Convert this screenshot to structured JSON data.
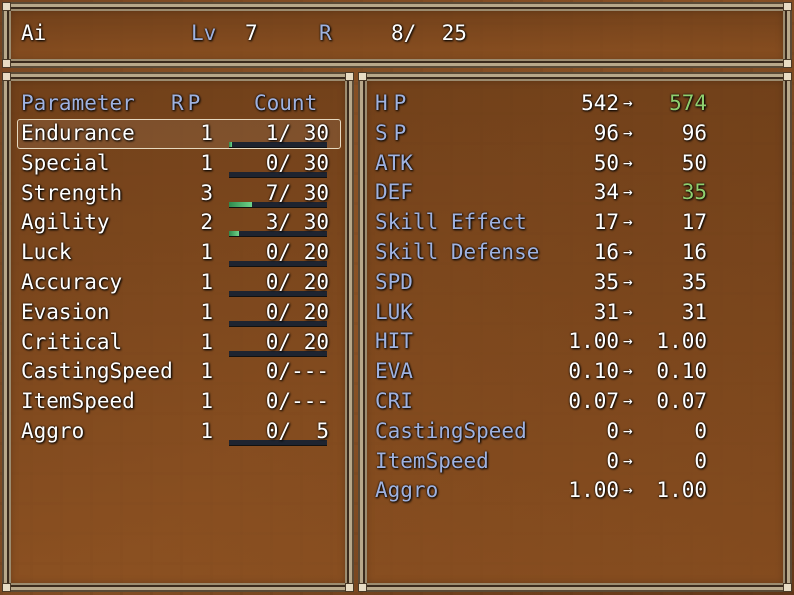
{
  "header": {
    "name": "Ai",
    "level_label": "Lv",
    "level": "7",
    "points_label": "R",
    "points": "8/  25"
  },
  "params_table": {
    "headers": {
      "parameter": "Parameter",
      "rp": "RP",
      "count": "Count"
    },
    "rows": [
      {
        "name": "Endurance",
        "rp": "1",
        "count": "1/ 30",
        "progress": 0.033,
        "has_bar": true
      },
      {
        "name": "Special",
        "rp": "1",
        "count": "0/ 30",
        "progress": 0.0,
        "has_bar": true
      },
      {
        "name": "Strength",
        "rp": "3",
        "count": "7/ 30",
        "progress": 0.233,
        "has_bar": true
      },
      {
        "name": "Agility",
        "rp": "2",
        "count": "3/ 30",
        "progress": 0.1,
        "has_bar": true
      },
      {
        "name": "Luck",
        "rp": "1",
        "count": "0/ 20",
        "progress": 0.0,
        "has_bar": true
      },
      {
        "name": "Accuracy",
        "rp": "1",
        "count": "0/ 20",
        "progress": 0.0,
        "has_bar": true
      },
      {
        "name": "Evasion",
        "rp": "1",
        "count": "0/ 20",
        "progress": 0.0,
        "has_bar": true
      },
      {
        "name": "Critical",
        "rp": "1",
        "count": "0/ 20",
        "progress": 0.0,
        "has_bar": true
      },
      {
        "name": "CastingSpeed",
        "rp": "1",
        "count": "0/---",
        "progress": 0.0,
        "has_bar": false
      },
      {
        "name": "ItemSpeed",
        "rp": "1",
        "count": "0/---",
        "progress": 0.0,
        "has_bar": false
      },
      {
        "name": "Aggro",
        "rp": "1",
        "count": "0/  5",
        "progress": 0.0,
        "has_bar": true
      }
    ],
    "selected_index": 0
  },
  "stats": {
    "arrow": "→",
    "rows": [
      {
        "name": "HP",
        "current": "542",
        "next": "574",
        "increased": true,
        "system": true
      },
      {
        "name": "SP",
        "current": "96",
        "next": "96",
        "increased": false,
        "system": true
      },
      {
        "name": "ATK",
        "current": "50",
        "next": "50",
        "increased": false,
        "system": true
      },
      {
        "name": "DEF",
        "current": "34",
        "next": "35",
        "increased": true,
        "system": true
      },
      {
        "name": "Skill Effect",
        "current": "17",
        "next": "17",
        "increased": false,
        "system": true
      },
      {
        "name": "Skill Defense",
        "current": "16",
        "next": "16",
        "increased": false,
        "system": true
      },
      {
        "name": "SPD",
        "current": "35",
        "next": "35",
        "increased": false,
        "system": true
      },
      {
        "name": "LUK",
        "current": "31",
        "next": "31",
        "increased": false,
        "system": true
      },
      {
        "name": "HIT",
        "current": "1.00",
        "next": "1.00",
        "increased": false,
        "system": true
      },
      {
        "name": "EVA",
        "current": "0.10",
        "next": "0.10",
        "increased": false,
        "system": true
      },
      {
        "name": "CRI",
        "current": "0.07",
        "next": "0.07",
        "increased": false,
        "system": true
      },
      {
        "name": "CastingSpeed",
        "current": "0",
        "next": "0",
        "increased": false,
        "system": true
      },
      {
        "name": "ItemSpeed",
        "current": "0",
        "next": "0",
        "increased": false,
        "system": true
      },
      {
        "name": "Aggro",
        "current": "1.00",
        "next": "1.00",
        "increased": false,
        "system": true
      }
    ]
  },
  "colors": {
    "system_text": "#9fb2e0",
    "normal_text": "#ffffff",
    "increase_text": "#8fcf6f",
    "gauge_fill": "#4cb86a",
    "window_frame": "#b8a88a"
  }
}
